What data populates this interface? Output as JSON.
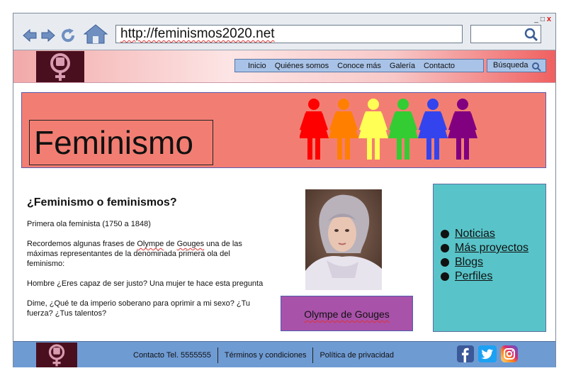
{
  "browser": {
    "url": "http://feminismos2020.net",
    "window_controls": [
      "_",
      "□",
      "x"
    ]
  },
  "nav": {
    "items": [
      "Inicio",
      "Quiénes somos",
      "Conoce más",
      "Galería",
      "Contacto"
    ],
    "search_label": "Búsqueda"
  },
  "hero": {
    "title": "Feminismo",
    "figure_colors": [
      "#ff0000",
      "#ff7f00",
      "#ffff55",
      "#33cc33",
      "#3344ee",
      "#800080"
    ]
  },
  "article": {
    "heading": "¿Feminismo o feminismos?",
    "period": "Primera ola feminista (1750 a 1848)",
    "intro_before": "Recordemos algunas frases de ",
    "intro_name": "Olympe",
    "intro_de": " de ",
    "intro_surname": "Gouges",
    "intro_after": " una de las máximas representantes de la denominada primera ola del feminismo:",
    "quote1": "Hombre ¿Eres capaz de ser justo? Una mujer te hace esta pregunta",
    "quote2": "Dime, ¿Qué te da imperio soberano para oprimir a mi sexo? ¿Tu fuerza? ¿Tus talentos?"
  },
  "portrait": {
    "caption": "Olympe de Gouges"
  },
  "sidebar": {
    "links": [
      "Noticias",
      "Más proyectos",
      "Blogs",
      "Perfiles"
    ]
  },
  "footer": {
    "links": [
      "Contacto Tel. 5555555",
      "Términos y condiciones",
      "Política de privacidad"
    ],
    "social_icons": [
      "facebook-icon",
      "twitter-icon",
      "instagram-icon"
    ]
  },
  "colors": {
    "hero_bg": "#f27e73",
    "sidebar_bg": "#58c4c9",
    "caption_bg": "#a952a9",
    "footer_bg": "#6f9bd3",
    "nav_bg": "#a9c3e8"
  }
}
